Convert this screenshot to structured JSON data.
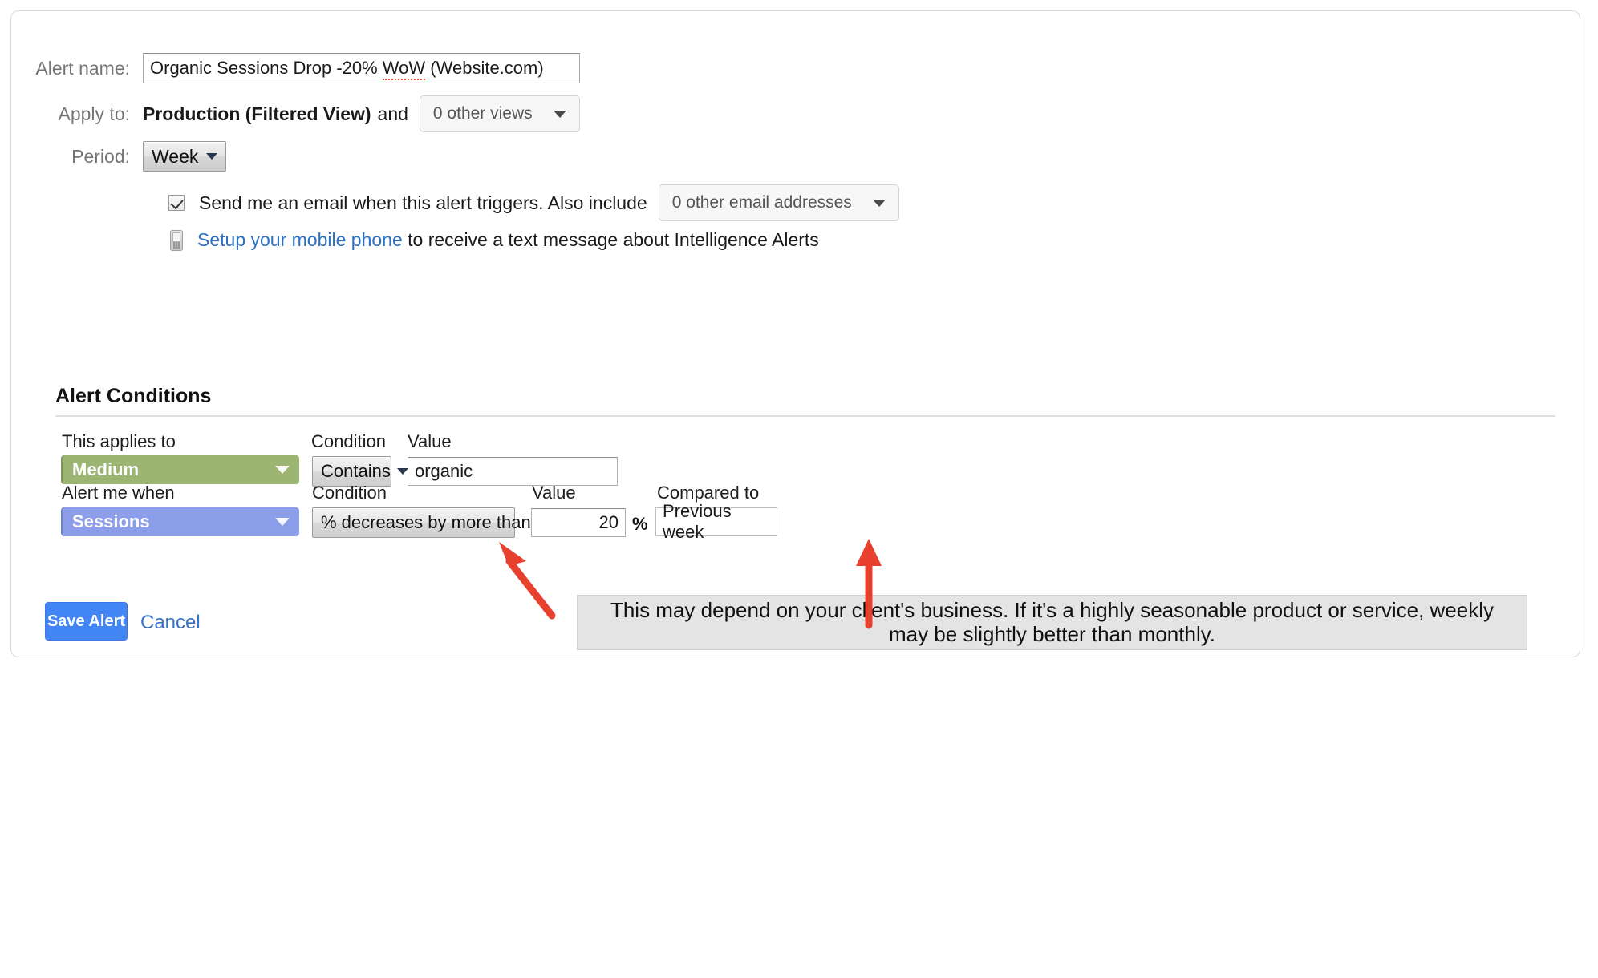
{
  "form": {
    "alert_name": {
      "label": "Alert name:",
      "value": "Organic Sessions Drop -20% WoW (Website.com)",
      "spellchecked_word": "WoW",
      "value_before": "Organic Sessions Drop -20% ",
      "value_after": " (Website.com)"
    },
    "apply_to": {
      "label": "Apply to:",
      "view_name": "Production (Filtered View)",
      "conjunction": "and",
      "other_views_label": "0 other views"
    },
    "period": {
      "label": "Period:",
      "value": "Week"
    },
    "email": {
      "checked": true,
      "text": "Send me an email when this alert triggers. Also include",
      "other_emails_label": "0 other email addresses"
    },
    "mobile": {
      "link_text": "Setup your mobile phone",
      "rest_text": "to receive a text message about Intelligence Alerts"
    }
  },
  "alert_conditions": {
    "title": "Alert Conditions",
    "row1": {
      "applies_label": "This applies to",
      "condition_label": "Condition",
      "value_label": "Value",
      "dimension": "Medium",
      "dimension_color": "#9cb573",
      "condition": "Contains",
      "value": "organic"
    },
    "row2": {
      "alert_label": "Alert me when",
      "condition_label": "Condition",
      "value_label": "Value",
      "compared_label": "Compared to",
      "metric": "Sessions",
      "metric_color": "#8c9eea",
      "condition": "% decreases by more than",
      "value": "20",
      "unit": "%",
      "compared_to": "Previous week"
    }
  },
  "actions": {
    "save_label": "Save Alert",
    "save_color": "#4285f4",
    "cancel_label": "Cancel"
  },
  "annotation": {
    "text": "This may depend on your client's business. If it's a highly seasonable product or service, weekly may be slightly better than monthly.",
    "arrow_color": "#e8402f",
    "arrow_targets": [
      "condition-dropdown-decreases",
      "compared-to-field"
    ]
  }
}
